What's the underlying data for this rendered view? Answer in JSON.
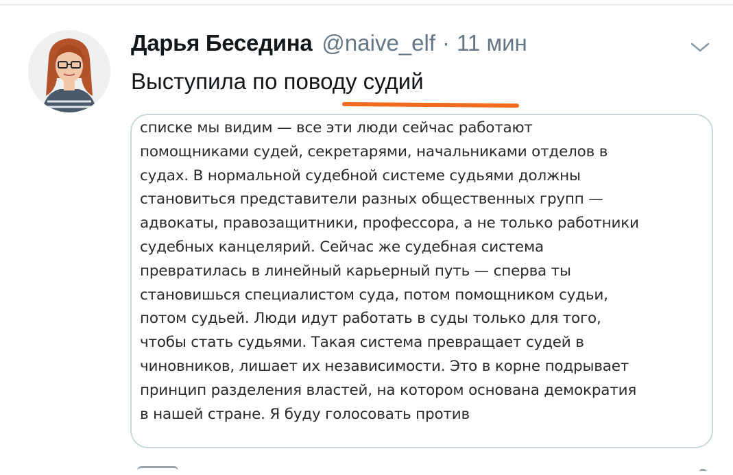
{
  "tweet": {
    "author": {
      "display_name": "Дарья Беседина",
      "handle": "@naive_elf",
      "avatar_icon": "user-avatar"
    },
    "separator": "·",
    "timestamp": "11 мин",
    "text": "Выступила по поводу судий",
    "menu_icon": "chevron-down-icon",
    "highlight_color": "#f26b1d",
    "media": {
      "lines": [
        "списке мы видим — все эти люди сейчас работают",
        "помощниками судей, секретарями, начальниками отделов в",
        "судах. В нормальной судебной системе судьями должны",
        "становиться представители разных общественных групп —",
        "адвокаты, правозащитники, профессора, а не только работники",
        "судебных канцелярий. Сейчас же судебная система",
        "превратилась в линейный карьерный путь — сперва ты",
        "становишься специалистом суда, потом помощником судьи,",
        "потом судьей. Люди идут работать в суды только для того,",
        "чтобы стать судьями. Такая система превращает судей в",
        "чиновников, лишает их независимости. Это в корне подрывает",
        "принцип разделения властей, на котором основана демократия",
        "в нашей стране. Я буду голосовать против"
      ]
    }
  }
}
